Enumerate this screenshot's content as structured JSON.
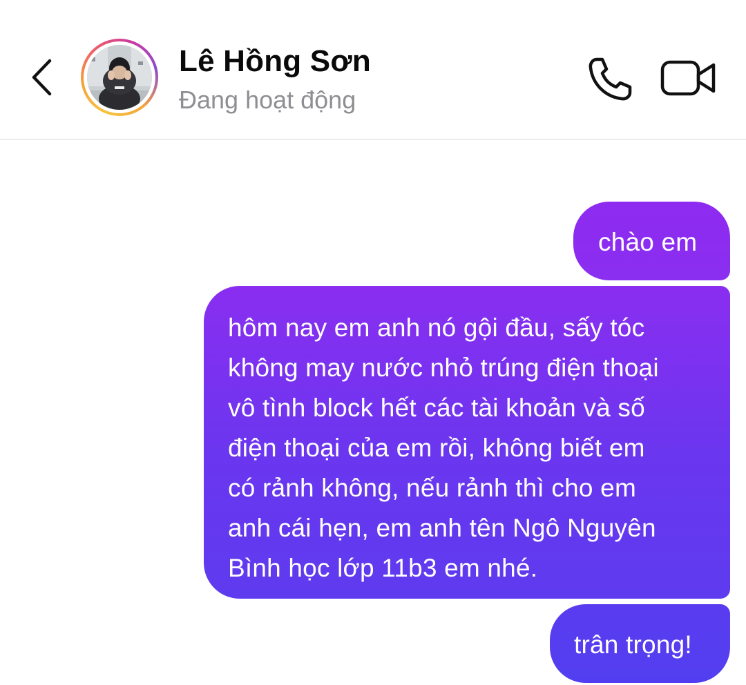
{
  "header": {
    "contact_name": "Lê Hồng Sơn",
    "contact_status": "Đang hoạt động",
    "icons": {
      "back": "chevron-left-icon",
      "call": "phone-icon",
      "video": "video-camera-icon"
    }
  },
  "messages": [
    {
      "sender": "me",
      "text": "chào em"
    },
    {
      "sender": "me",
      "text": "hôm nay em anh nó gội đầu, sấy tóc\nkhông may nước nhỏ trúng điện thoại\nvô tình block hết các tài khoản và số\nđiện thoại của em rồi, không biết em\ncó rảnh không, nếu rảnh thì cho em\nanh cái hẹn, em anh tên Ngô Nguyên\nBình học lớp 11b3 em nhé."
    },
    {
      "sender": "me",
      "text": "trân trọng!"
    }
  ],
  "colors": {
    "bubble_top": "#8e2bf0",
    "bubble_bottom": "#523ef0",
    "status_gray": "#8e8e93",
    "divider": "#d9d9d9"
  }
}
